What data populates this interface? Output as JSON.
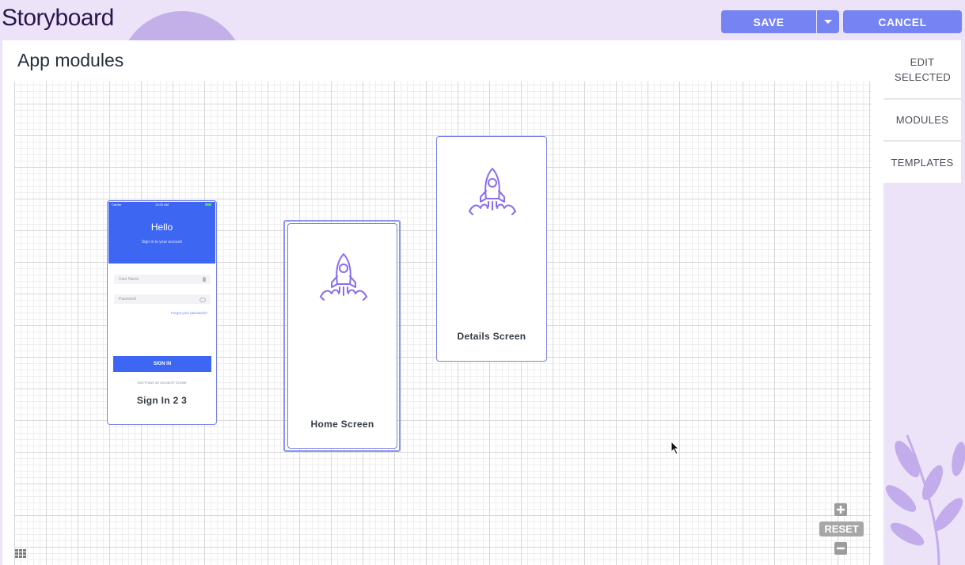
{
  "app": {
    "title": "Storyboard"
  },
  "toolbar": {
    "save_label": "SAVE",
    "cancel_label": "CANCEL"
  },
  "canvas": {
    "title": "App modules"
  },
  "side_tabs": [
    {
      "label": "EDIT SELECTED"
    },
    {
      "label": "MODULES"
    },
    {
      "label": "TEMPLATES"
    }
  ],
  "modules": [
    {
      "label": "Sign In 2 3",
      "preview": {
        "carrier": "Carrier",
        "time": "10:00 AM",
        "heading": "Hello",
        "subheading": "Sign in to your account",
        "username_placeholder": "User Name",
        "password_placeholder": "Password",
        "forgot": "Forgot your password?",
        "button": "SIGN IN",
        "footer": "Don't have an account? Create"
      }
    },
    {
      "label": "Home Screen",
      "icon": "rocket-icon"
    },
    {
      "label": "Details Screen",
      "icon": "rocket-icon"
    }
  ],
  "zoom": {
    "reset_label": "RESET"
  },
  "colors": {
    "accent": "#7583f3",
    "primary_blue": "#3d67f3",
    "rocket": "#8a6cf0",
    "card_border": "#7983e8"
  }
}
